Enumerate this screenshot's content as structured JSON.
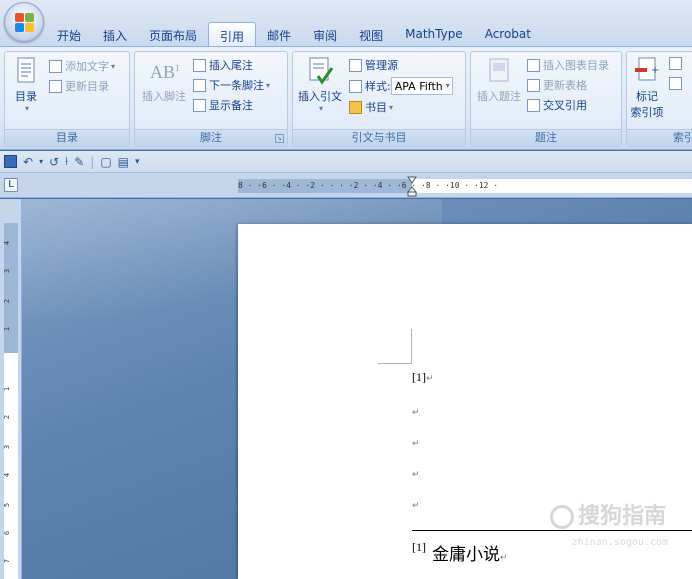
{
  "tabs": [
    {
      "label": "开始"
    },
    {
      "label": "插入"
    },
    {
      "label": "页面布局"
    },
    {
      "label": "引用",
      "active": true
    },
    {
      "label": "邮件"
    },
    {
      "label": "审阅"
    },
    {
      "label": "视图"
    },
    {
      "label": "MathType"
    },
    {
      "label": "Acrobat"
    }
  ],
  "ribbon": {
    "toc": {
      "big_label": "目录",
      "add_text": "添加文字",
      "update_toc": "更新目录",
      "group_label": "目录"
    },
    "footnotes": {
      "insert_footnote": "插入脚注",
      "insert_endnote": "插入尾注",
      "next_footnote": "下一条脚注",
      "show_notes": "显示备注",
      "group_label": "脚注"
    },
    "citations": {
      "insert_citation": "插入引文",
      "manage_sources": "管理源",
      "style_label": "样式:",
      "style_value": "APA Fifth",
      "bibliography": "书目",
      "group_label": "引文与书目"
    },
    "captions": {
      "insert_caption": "插入题注",
      "insert_table_of_figures": "插入图表目录",
      "update_table": "更新表格",
      "cross_reference": "交叉引用",
      "group_label": "题注"
    },
    "index": {
      "mark_entry_line1": "标记",
      "mark_entry_line2": "索引项",
      "group_label": "索引"
    }
  },
  "ruler": {
    "horizontal": "8 · ·6 · ·4 · ·2 · ·  · ·2 · ·4 · ·6 · ·8 · ·10 · ·12 ·",
    "vertical": [
      "4",
      "3",
      "2",
      "1",
      "1",
      "2",
      "3",
      "4",
      "5",
      "6",
      "7"
    ]
  },
  "document": {
    "ref_marker": "[1]",
    "paragraph_mark": "↵",
    "footnote_number": "[1]",
    "footnote_text": "金庸小说"
  },
  "watermark": {
    "text": "搜狗指南",
    "url": "zhinan.sogou.com"
  },
  "colors": {
    "accent": "#15428b",
    "ribbon_bg": "#dce7f5",
    "workspace": "#5f83b1"
  }
}
